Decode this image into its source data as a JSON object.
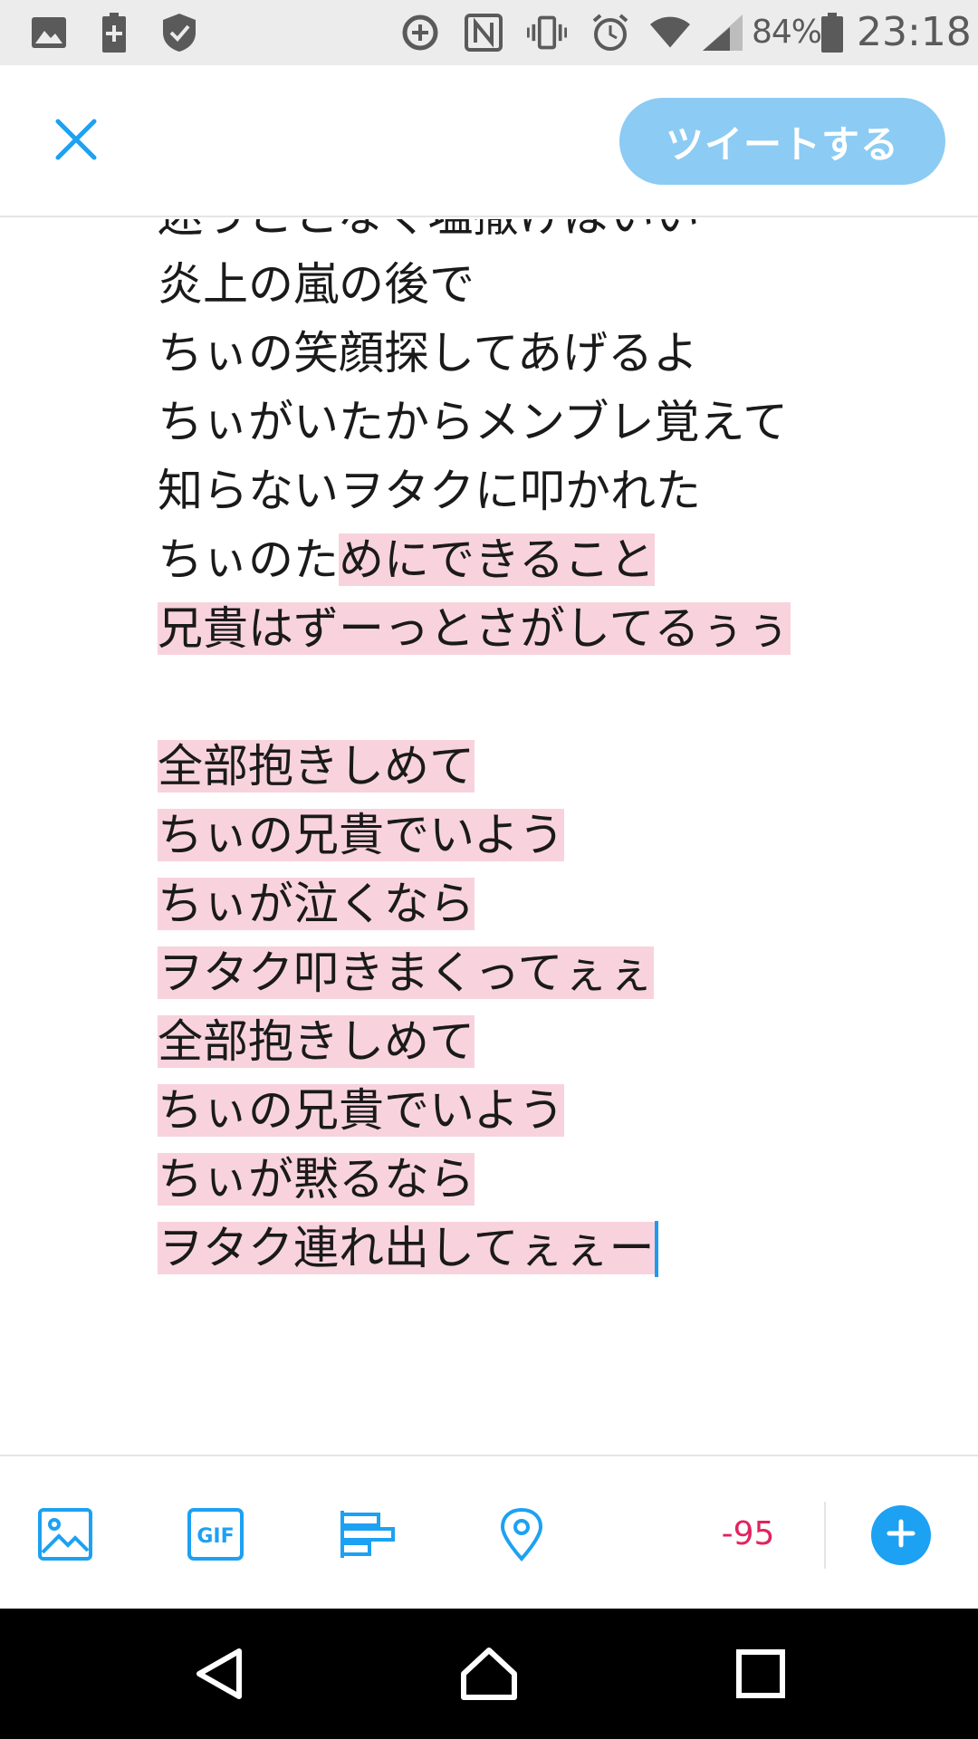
{
  "status_bar": {
    "battery_percent": "84%",
    "time": "23:18",
    "icons": [
      "image-icon",
      "battery-saver-icon",
      "shield-icon",
      "data-saver-icon",
      "nfc-icon",
      "vibrate-icon",
      "alarm-icon",
      "wifi-icon",
      "signal-icon",
      "battery-icon"
    ]
  },
  "header": {
    "close_icon": "close-icon",
    "tweet_button_label": "ツイートする"
  },
  "compose": {
    "lines": [
      {
        "pre": "迷うことなく塩撒けばいい",
        "hl": ""
      },
      {
        "pre": "炎上の嵐の後で",
        "hl": ""
      },
      {
        "pre": "ちぃの笑顔探してあげるよ",
        "hl": ""
      },
      {
        "pre": "ちぃがいたからメンブレ覚えて",
        "hl": ""
      },
      {
        "pre": "知らないヲタクに叩かれた",
        "hl": ""
      },
      {
        "pre": "ちぃのた",
        "hl": "めにできること"
      },
      {
        "pre": "",
        "hl": "兄貴はずーっとさがしてるぅぅ"
      },
      {
        "pre": "",
        "hl": ""
      },
      {
        "pre": "",
        "hl": "全部抱きしめて"
      },
      {
        "pre": "",
        "hl": "ちぃの兄貴でいよう"
      },
      {
        "pre": "",
        "hl": "ちぃが泣くなら"
      },
      {
        "pre": "",
        "hl": "ヲタク叩きまくってぇぇ"
      },
      {
        "pre": "",
        "hl": "全部抱きしめて"
      },
      {
        "pre": "",
        "hl": "ちぃの兄貴でいよう"
      },
      {
        "pre": "",
        "hl": "ちぃが黙るなら"
      },
      {
        "pre": "",
        "hl": "ヲタク連れ出してぇぇー"
      }
    ],
    "highlight_color": "#f8d3de",
    "caret_color": "#1d9bf0"
  },
  "toolbar": {
    "icons": [
      "image-icon",
      "gif-icon",
      "poll-icon",
      "location-icon"
    ],
    "gif_label": "GIF",
    "char_count": "-95",
    "char_count_color": "#e0245e",
    "add_icon": "plus-icon"
  },
  "nav_bar": {
    "icons": [
      "back-icon",
      "home-icon",
      "recents-icon"
    ]
  },
  "colors": {
    "accent": "#1da1f2",
    "tweet_button_disabled": "#8ccbf3"
  }
}
